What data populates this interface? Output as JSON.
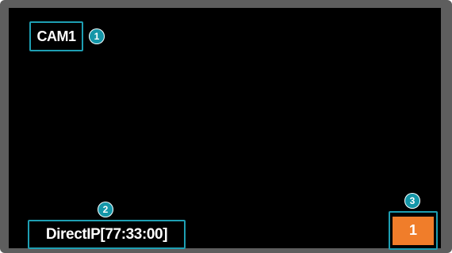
{
  "osd": {
    "camera_title": "CAM1",
    "connection_status": "DirectIP[77:33:00]",
    "channel_number": "1"
  },
  "callouts": [
    "1",
    "2",
    "3"
  ],
  "colors": {
    "highlight_border": "#1e9fb3",
    "callout_fill": "#1496a8",
    "channel_badge": "#f07d2a",
    "screen_background": "#000000",
    "bezel": "#5e5e5e"
  }
}
